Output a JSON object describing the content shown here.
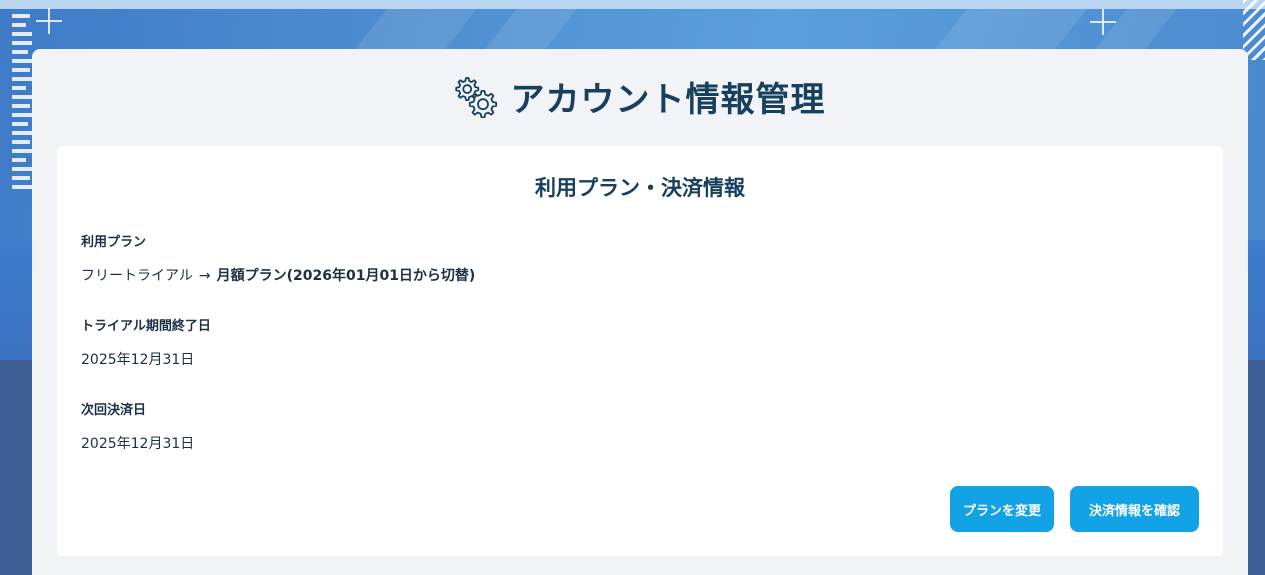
{
  "header": {
    "title": "アカウント情報管理",
    "icon": "gears-icon"
  },
  "card": {
    "title": "利用プラン・決済情報",
    "plan": {
      "label": "利用プラン",
      "current": "フリートライアル",
      "arrow": "→",
      "next": "月額プラン(2026年01月01日から切替)"
    },
    "trial_end": {
      "label": "トライアル期間終了日",
      "value": "2025年12月31日"
    },
    "next_payment": {
      "label": "次回決済日",
      "value": "2025年12月31日"
    },
    "buttons": {
      "change_plan": "プランを変更",
      "check_payment": "決済情報を確認"
    }
  },
  "colors": {
    "accent": "#12a3e6",
    "title_text": "#17405e",
    "panel_bg": "#f1f3f6"
  }
}
